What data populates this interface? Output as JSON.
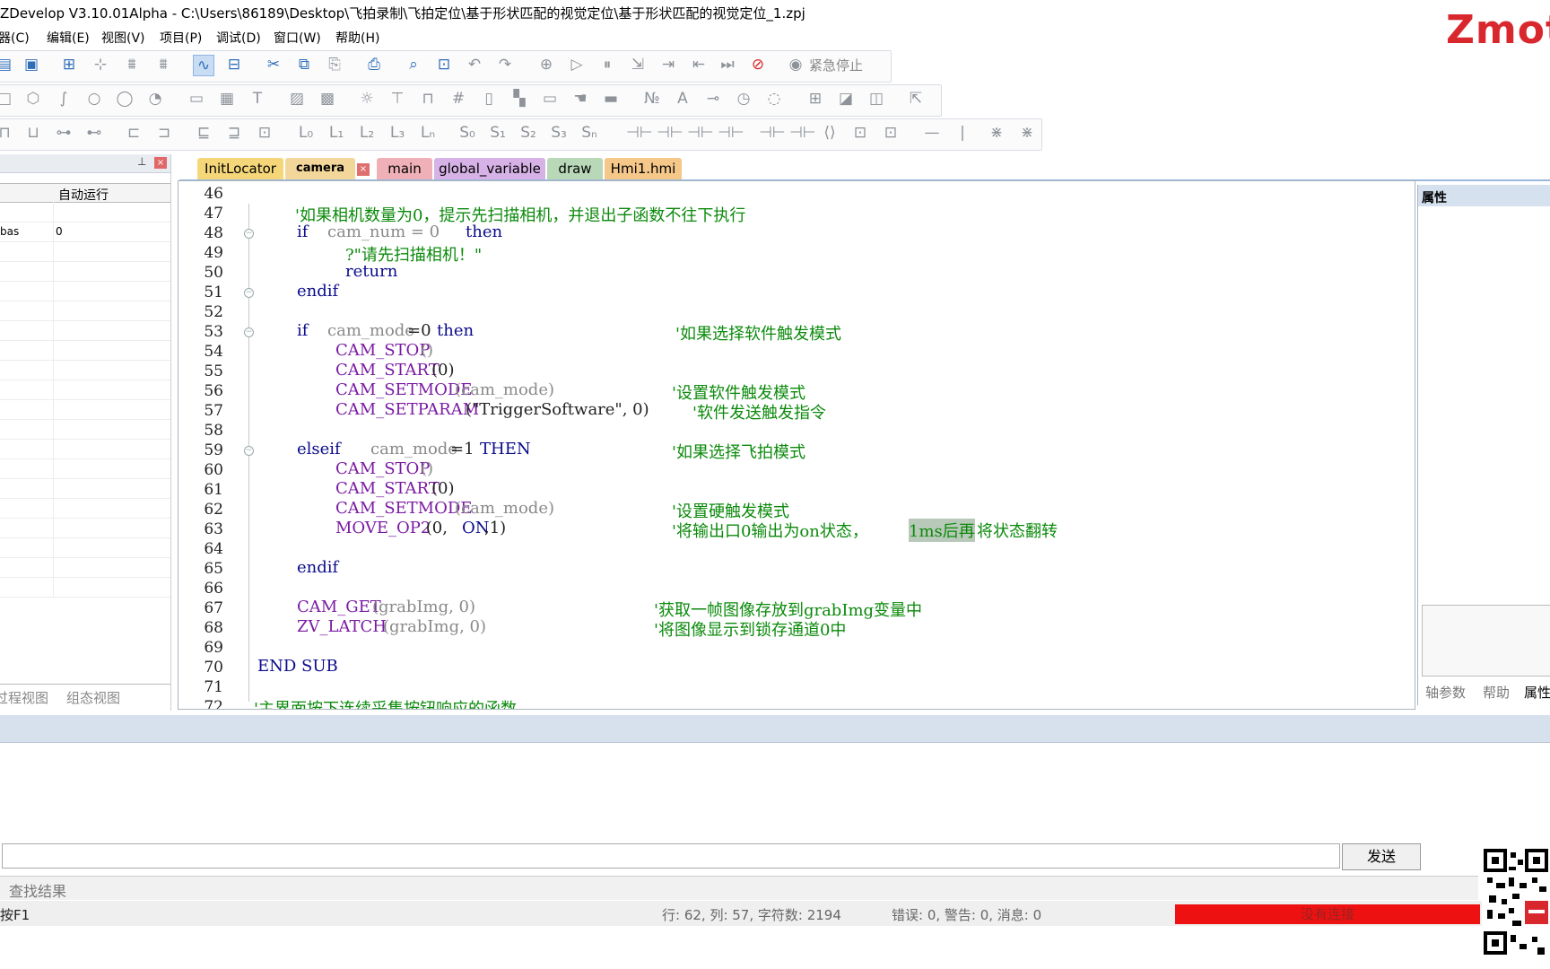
{
  "window": {
    "title": "ZDevelop V3.10.01Alpha - C:\\Users\\86189\\Desktop\\飞拍录制\\飞拍定位\\基于形状匹配的视觉定位\\基于形状匹配的视觉定位_1.zpj",
    "logo_text": "Zmot"
  },
  "menu": [
    "编程器(C)",
    "编辑(E)",
    "视图(V)",
    "项目(P)",
    "调试(D)",
    "窗口(W)",
    "帮助(H)"
  ],
  "toolbar": {
    "estop_label": "紧急停止"
  },
  "left_panel": {
    "column_header": "自动运行",
    "rows": [
      {
        "name": "bas",
        "value": "0"
      }
    ],
    "bottom_tabs": [
      "过程视图",
      "组态视图"
    ]
  },
  "tabs": [
    {
      "label": "InitLocator",
      "color": "#f5d77a",
      "active": false
    },
    {
      "label": "camera",
      "color": "#f3d79a",
      "active": true
    },
    {
      "label": "main",
      "color": "#f0b0b8",
      "active": false
    },
    {
      "label": "global_variable",
      "color": "#d6b2e6",
      "active": false
    },
    {
      "label": "draw",
      "color": "#b8d8b8",
      "active": false
    },
    {
      "label": "Hmi1.hmi",
      "color": "#f5c88a",
      "active": false
    }
  ],
  "editor": {
    "line_numbers": [
      "46",
      "47",
      "48",
      "49",
      "50",
      "51",
      "52",
      "53",
      "54",
      "55",
      "56",
      "57",
      "58",
      "59",
      "60",
      "61",
      "62",
      "63",
      "64",
      "65",
      "66",
      "67",
      "68",
      "69",
      "70",
      "71",
      "72"
    ],
    "code": {
      "l47_comment": "'如果相机数量为0，提示先扫描相机，并退出子函数不往下执行",
      "l48_if": "if",
      "l48_var": "cam_num = 0",
      "l48_then": "then",
      "l49_str": "?\"请先扫描相机！\"",
      "l50_return": "return",
      "l51_endif": "endif",
      "l53_if": "if",
      "l53_var": "cam_mode",
      "l53_rest": "=0",
      "l53_then": "then",
      "l53_comment": "'如果选择软件触发模式",
      "l54_fn": "CAM_STOP",
      "l54_args": "()",
      "l55_fn": "CAM_START",
      "l55_args": "(0)",
      "l56_fn": "CAM_SETMODE",
      "l56_args": "(cam_mode)",
      "l56_comment": "'设置软件触发模式",
      "l57_fn": "CAM_SETPARAM",
      "l57_args": "(\"TriggerSoftware\", 0)",
      "l57_comment": "'软件发送触发指令",
      "l59_elseif": "elseif",
      "l59_var": "cam_mode",
      "l59_rest": "=1",
      "l59_then": "THEN",
      "l59_comment": "'如果选择飞拍模式",
      "l60_fn": "CAM_STOP",
      "l60_args": "()",
      "l61_fn": "CAM_START",
      "l61_args": "(0)",
      "l62_fn": "CAM_SETMODE",
      "l62_args": "(cam_mode)",
      "l62_comment": "'设置硬触发模式",
      "l63_fn": "MOVE_OP2",
      "l63_args": " (0,",
      "l63_on": "ON",
      "l63_args2": ",1)",
      "l63_comment_a": "'将输出口0输出为on状态，",
      "l63_comment_hl": "1ms后再",
      "l63_comment_b": "将状态翻转",
      "l65_endif": "endif",
      "l67_fn": "CAM_GET",
      "l67_args": "(grabImg, 0)",
      "l67_comment": "'获取一帧图像存放到grabImg变量中",
      "l68_fn": "ZV_LATCH",
      "l68_args": "(grabImg, 0)",
      "l68_comment": "'将图像显示到锁存通道0中",
      "l70_end": "END SUB",
      "l72_comment": "'主界面按下连续采集按钮响应的函数"
    }
  },
  "properties": {
    "header": "属性",
    "tabs": [
      "轴参数",
      "帮助",
      "属性"
    ]
  },
  "output": {
    "send_label": "发送",
    "bottom_tab": "查找结果"
  },
  "status": {
    "help_hint": "按F1",
    "position": "行: 62, 列: 57, 字符数: 2194",
    "messages": "错误: 0, 警告: 0, 消息: 0",
    "connection": "没有连接"
  },
  "colors": {
    "keyword": "#0a0a8c",
    "function": "#7a1aa3",
    "comment": "#0b8a0b",
    "status_error": "#ee1111"
  }
}
